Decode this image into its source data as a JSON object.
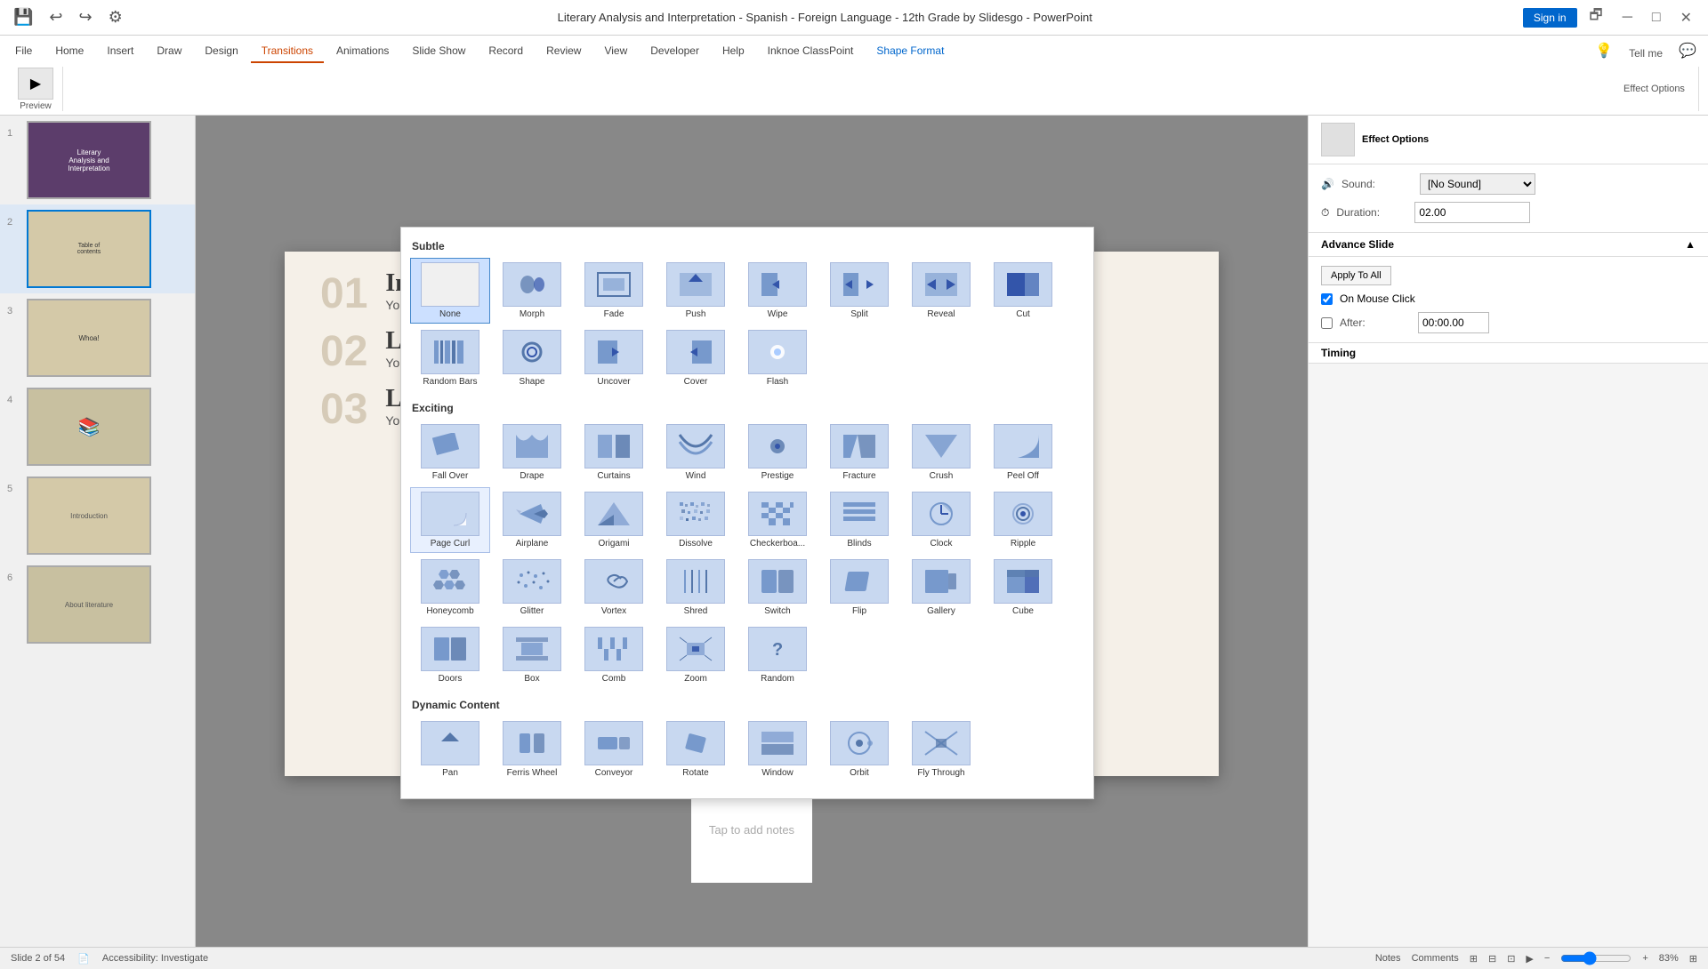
{
  "titlebar": {
    "title": "Literary Analysis and Interpretation - Spanish - Foreign Language - 12th Grade by Slidesgo - PowerPoint",
    "sign_in": "Sign in"
  },
  "ribbon": {
    "tabs": [
      "File",
      "Home",
      "Insert",
      "Draw",
      "Design",
      "Transitions",
      "Animations",
      "Slide Show",
      "Record",
      "Review",
      "View",
      "Developer",
      "Help",
      "Inknoe ClassPoint",
      "Shape Format"
    ],
    "active_tab": "Transitions",
    "tell_me": "Tell me",
    "right_panel_title": "Shape Format"
  },
  "transitions_panel": {
    "subtle_label": "Subtle",
    "exciting_label": "Exciting",
    "dynamic_label": "Dynamic Content",
    "subtle_items": [
      {
        "name": "None",
        "icon": "⬜"
      },
      {
        "name": "Morph",
        "icon": "◈"
      },
      {
        "name": "Fade",
        "icon": "▣"
      },
      {
        "name": "Push",
        "icon": "⬆"
      },
      {
        "name": "Wipe",
        "icon": "⇦"
      },
      {
        "name": "Split",
        "icon": "↔"
      },
      {
        "name": "Reveal",
        "icon": "↔"
      },
      {
        "name": "Cut",
        "icon": "◼"
      },
      {
        "name": "Random Bars",
        "icon": "≡"
      },
      {
        "name": "Shape",
        "icon": "⬡"
      },
      {
        "name": "Uncover",
        "icon": "⇐"
      },
      {
        "name": "Cover",
        "icon": "⇐"
      },
      {
        "name": "Flash",
        "icon": "✦"
      }
    ],
    "exciting_items": [
      {
        "name": "Fall Over",
        "icon": "⧄"
      },
      {
        "name": "Drape",
        "icon": "⧄"
      },
      {
        "name": "Curtains",
        "icon": "⧄"
      },
      {
        "name": "Wind",
        "icon": "⧄"
      },
      {
        "name": "Prestige",
        "icon": "✦"
      },
      {
        "name": "Fracture",
        "icon": "❋"
      },
      {
        "name": "Crush",
        "icon": "❋"
      },
      {
        "name": "Peel Off",
        "icon": "⧄"
      },
      {
        "name": "Page Curl",
        "icon": "⧄"
      },
      {
        "name": "Airplane",
        "icon": "✈"
      },
      {
        "name": "Origami",
        "icon": "⧄"
      },
      {
        "name": "Dissolve",
        "icon": "⠿"
      },
      {
        "name": "Checkerboard...",
        "icon": "⠿"
      },
      {
        "name": "Blinds",
        "icon": "≡"
      },
      {
        "name": "Clock",
        "icon": "◎"
      },
      {
        "name": "Ripple",
        "icon": "◎"
      },
      {
        "name": "Honeycomb",
        "icon": "⬡"
      },
      {
        "name": "Glitter",
        "icon": "⠿"
      },
      {
        "name": "Vortex",
        "icon": "↻"
      },
      {
        "name": "Shred",
        "icon": "≡"
      },
      {
        "name": "Switch",
        "icon": "⧈"
      },
      {
        "name": "Flip",
        "icon": "⧈"
      },
      {
        "name": "Gallery",
        "icon": "⧈"
      },
      {
        "name": "Cube",
        "icon": "⬛"
      },
      {
        "name": "Doors",
        "icon": "⧈"
      },
      {
        "name": "Box",
        "icon": "⬛"
      },
      {
        "name": "Comb",
        "icon": "≡"
      },
      {
        "name": "Zoom",
        "icon": "⊕"
      },
      {
        "name": "Random",
        "icon": "?"
      }
    ],
    "dynamic_items": [
      {
        "name": "Pan",
        "icon": "⬆"
      },
      {
        "name": "Ferris Wheel",
        "icon": "◎"
      },
      {
        "name": "Conveyor",
        "icon": "▣"
      },
      {
        "name": "Rotate",
        "icon": "↻"
      },
      {
        "name": "Window",
        "icon": "⊞"
      },
      {
        "name": "Orbit",
        "icon": "◎"
      },
      {
        "name": "Fly Through",
        "icon": "✈"
      }
    ]
  },
  "timing": {
    "sound_label": "Sound:",
    "sound_value": "[No Sound]",
    "duration_label": "Duration:",
    "duration_value": "02.00",
    "advance_label": "Advance Slide",
    "on_mouse_click": "On Mouse Click",
    "after_label": "After:",
    "after_value": "00:00.00",
    "apply_all": "Apply To All",
    "label": "Timing"
  },
  "slide_panel": {
    "slides": [
      {
        "num": "1",
        "label": "Literary Analysis"
      },
      {
        "num": "2",
        "label": "Table of contents"
      },
      {
        "num": "3",
        "label": "Whoa!"
      },
      {
        "num": "4",
        "label": "Books"
      },
      {
        "num": "5",
        "label": "Introduction"
      },
      {
        "num": "6",
        "label": "About literature"
      }
    ]
  },
  "slide_content": {
    "sections": [
      {
        "num": "01",
        "title": "Introduction",
        "desc": "You can describe the topic of the section here"
      },
      {
        "num": "02",
        "title": "Literary analysis",
        "desc": "You can describe the topic of the section here"
      },
      {
        "num": "03",
        "title": "Literary interpretation",
        "desc": "You can describe the topic of the section here"
      }
    ]
  },
  "notes": {
    "placeholder": "Tap to add notes"
  },
  "statusbar": {
    "slide_count": "Slide 2 of 54",
    "accessibility": "Accessibility: Investigate",
    "notes": "Notes",
    "comments": "Comments",
    "zoom": "83%"
  },
  "effect_options": {
    "label": "Effect Options"
  }
}
